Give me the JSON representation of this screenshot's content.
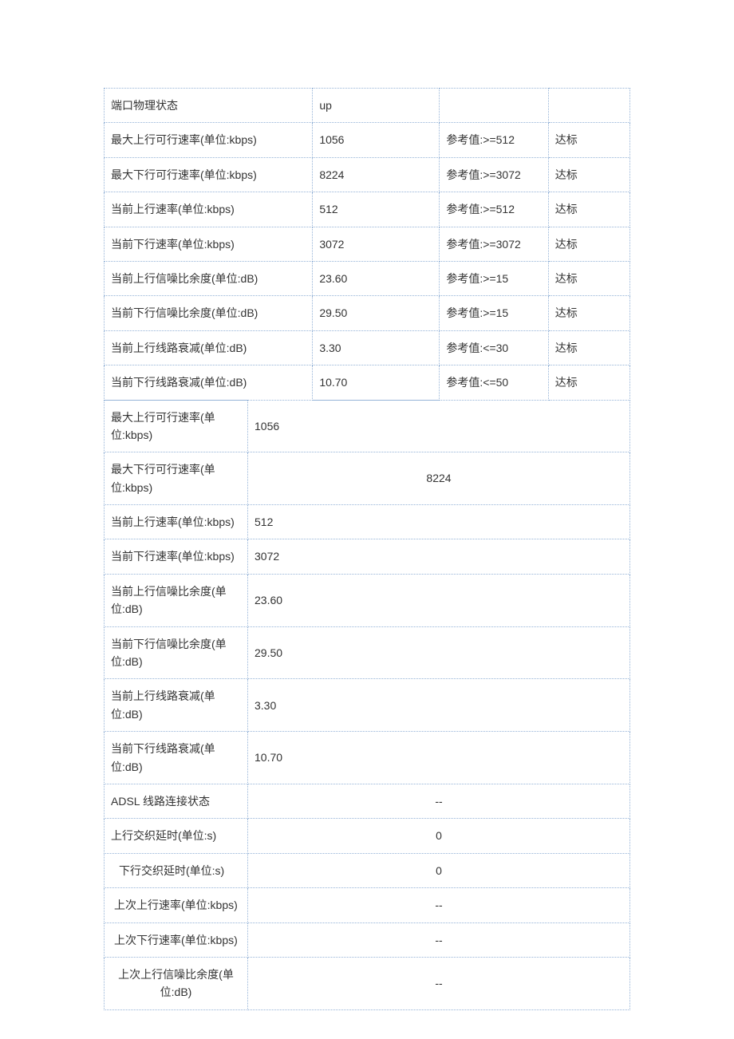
{
  "table1": {
    "rows": [
      {
        "label": "端口物理状态",
        "value": "up",
        "ref": "",
        "pass": ""
      },
      {
        "label": "最大上行可行速率(单位:kbps)",
        "value": "1056",
        "ref": "参考值:>=512",
        "pass": "达标"
      },
      {
        "label": "最大下行可行速率(单位:kbps)",
        "value": "8224",
        "ref": "参考值:>=3072",
        "pass": "达标"
      },
      {
        "label": "当前上行速率(单位:kbps)",
        "value": "512",
        "ref": "参考值:>=512",
        "pass": "达标"
      },
      {
        "label": "当前下行速率(单位:kbps)",
        "value": "3072",
        "ref": "参考值:>=3072",
        "pass": "达标"
      },
      {
        "label": "当前上行信噪比余度(单位:dB)",
        "value": "23.60",
        "ref": "参考值:>=15",
        "pass": "达标"
      },
      {
        "label": "当前下行信噪比余度(单位:dB)",
        "value": "29.50",
        "ref": "参考值:>=15",
        "pass": "达标"
      },
      {
        "label": "当前上行线路衰减(单位:dB)",
        "value": "3.30",
        "ref": "参考值:<=30",
        "pass": "达标"
      },
      {
        "label": "当前下行线路衰减(单位:dB)",
        "value": "10.70",
        "ref": "参考值:<=50",
        "pass": "达标"
      }
    ]
  },
  "table2": {
    "rows": [
      {
        "label": "最大上行可行速率(单位:kbps)",
        "value": "1056",
        "valueAlign": "left",
        "labelAlign": "left"
      },
      {
        "label": "最大下行可行速率(单位:kbps)",
        "value": "8224",
        "valueAlign": "center",
        "labelAlign": "left"
      },
      {
        "label": "当前上行速率(单位:kbps)",
        "value": "512",
        "valueAlign": "left",
        "labelAlign": "left"
      },
      {
        "label": "当前下行速率(单位:kbps)",
        "value": "3072",
        "valueAlign": "left",
        "labelAlign": "left"
      },
      {
        "label": "当前上行信噪比余度(单位:dB)",
        "value": "23.60",
        "valueAlign": "left",
        "labelAlign": "left"
      },
      {
        "label": "当前下行信噪比余度(单位:dB)",
        "value": "29.50",
        "valueAlign": "left",
        "labelAlign": "left"
      },
      {
        "label": "当前上行线路衰减(单位:dB)",
        "value": "3.30",
        "valueAlign": "left",
        "labelAlign": "left"
      },
      {
        "label": "当前下行线路衰减(单位:dB)",
        "value": "10.70",
        "valueAlign": "left",
        "labelAlign": "left"
      },
      {
        "label": "ADSL 线路连接状态",
        "value": "--",
        "valueAlign": "center",
        "labelAlign": "left"
      },
      {
        "label": "上行交织延时(单位:s)",
        "value": "0",
        "valueAlign": "center",
        "labelAlign": "left"
      },
      {
        "label": "下行交织延时(单位:s)",
        "value": "0",
        "valueAlign": "center",
        "labelAlign": "center-ish"
      },
      {
        "label": "上次上行速率(单位:kbps)",
        "value": "--",
        "valueAlign": "center",
        "labelAlign": "left-ish"
      },
      {
        "label": "上次下行速率(单位:kbps)",
        "value": "--",
        "valueAlign": "center",
        "labelAlign": "left-ish"
      },
      {
        "label": "上次上行信噪比余度(单位:dB)",
        "value": "--",
        "valueAlign": "center",
        "labelAlign": "center"
      }
    ]
  }
}
